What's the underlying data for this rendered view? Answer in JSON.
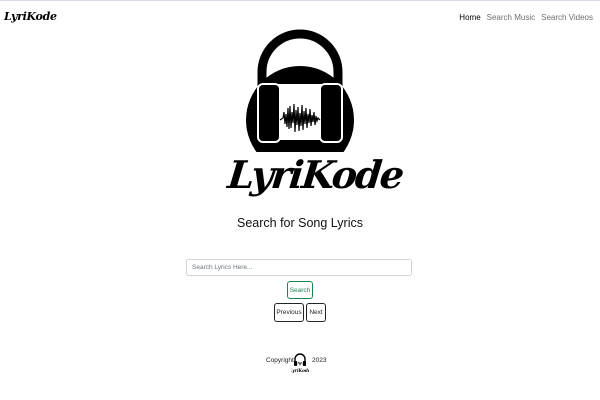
{
  "navbar": {
    "brand": "LyriKode",
    "links": [
      {
        "label": "Home",
        "active": true
      },
      {
        "label": "Search Music",
        "active": false
      },
      {
        "label": "Search Videos",
        "active": false
      }
    ]
  },
  "hero": {
    "logo_text": "LyriKode",
    "logo_icon": "headphones-icon",
    "tagline": "Search for Song Lyrics"
  },
  "search": {
    "placeholder": "Search Lyrics Here...",
    "value": "",
    "button_label": "Search"
  },
  "pagination": {
    "previous_label": "Previous",
    "next_label": "Next"
  },
  "footer": {
    "copyright_label": "Copyright",
    "logo_text": "LyriKode",
    "year": "2023"
  },
  "colors": {
    "search_button": "#198754",
    "text": "#212529",
    "nav_muted": "#6c6f74"
  }
}
